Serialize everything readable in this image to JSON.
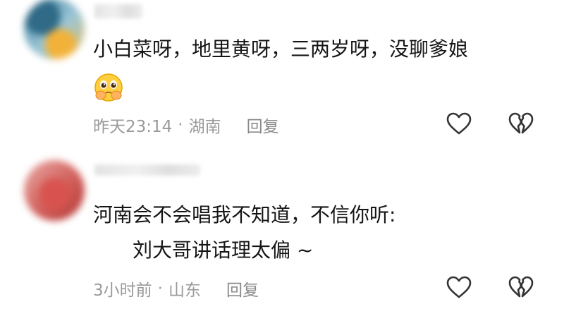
{
  "comments": [
    {
      "text": "小白菜呀，地里黄呀，三两岁呀，没聊爹娘",
      "emoji": "pleading-face-hands-icon",
      "time": "昨天23:14",
      "separator": "·",
      "location": "湖南",
      "reply_label": "回复"
    },
    {
      "text": "河南会不会唱我不知道，不信你听:",
      "text2": "刘大哥讲话理太偏 ~",
      "time": "3小时前",
      "separator": "·",
      "location": "山东",
      "reply_label": "回复"
    }
  ],
  "colors": {
    "meta_text": "#9a9a9a",
    "body_text": "#151515",
    "icon_stroke": "#333333"
  }
}
